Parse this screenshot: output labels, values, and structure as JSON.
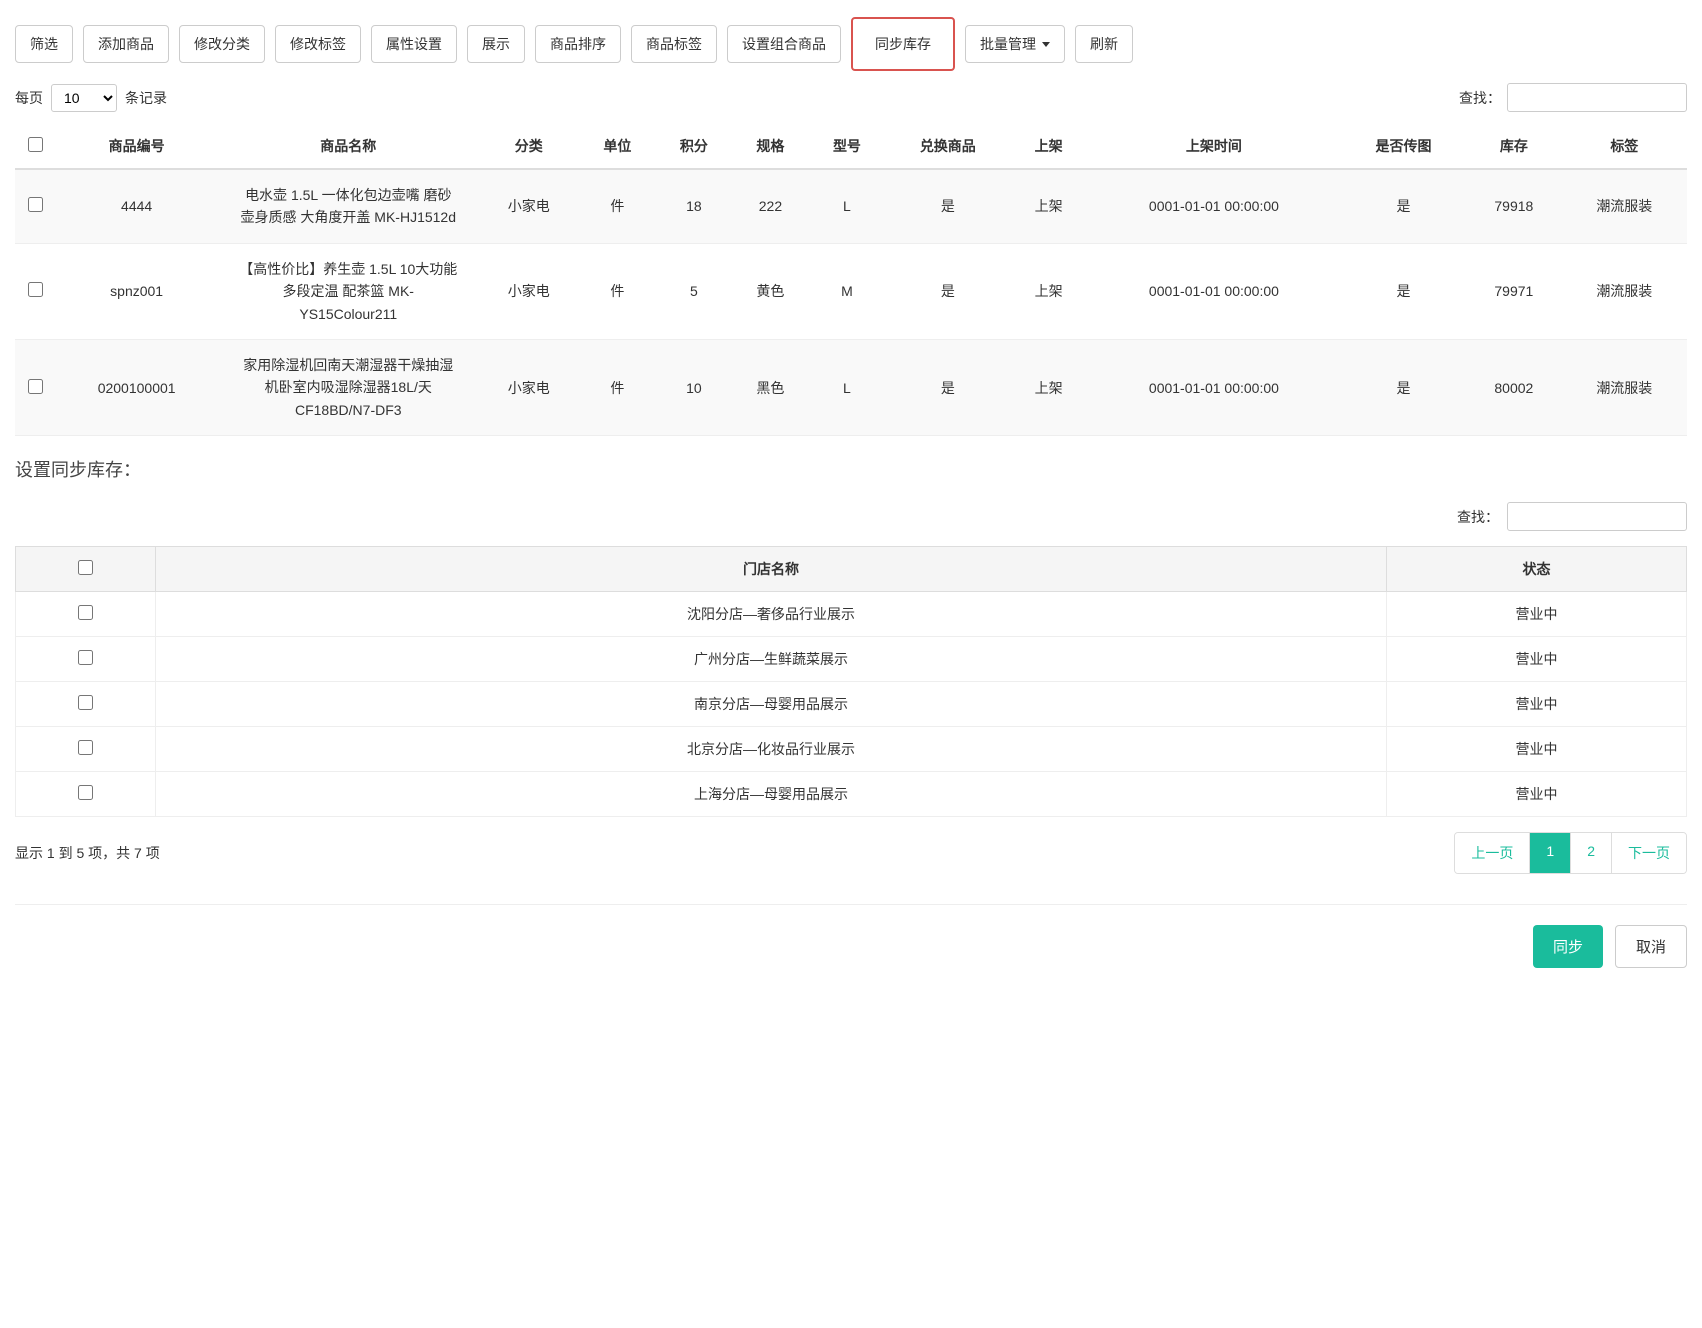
{
  "toolbar": {
    "filter": "筛选",
    "add_product": "添加商品",
    "edit_category": "修改分类",
    "edit_tags": "修改标签",
    "attr_settings": "属性设置",
    "display": "展示",
    "product_sort": "商品排序",
    "product_tags": "商品标签",
    "set_combo": "设置组合商品",
    "sync_stock": "同步库存",
    "batch_manage": "批量管理",
    "refresh": "刷新"
  },
  "page_size": {
    "prefix": "每页",
    "value": "10",
    "suffix": "条记录"
  },
  "search_label": "查找：",
  "product_table": {
    "headers": {
      "code": "商品编号",
      "name": "商品名称",
      "category": "分类",
      "unit": "单位",
      "points": "积分",
      "spec": "规格",
      "model": "型号",
      "exchange": "兑换商品",
      "on_shelf": "上架",
      "shelf_time": "上架时间",
      "has_image": "是否传图",
      "stock": "库存",
      "tags": "标签"
    },
    "rows": [
      {
        "code": "4444",
        "name": "电水壶 1.5L 一体化包边壶嘴 磨砂壶身质感 大角度开盖 MK-HJ1512d",
        "category": "小家电",
        "unit": "件",
        "points": "18",
        "spec": "222",
        "model": "L",
        "exchange": "是",
        "on_shelf": "上架",
        "shelf_time": "0001-01-01 00:00:00",
        "has_image": "是",
        "stock": "79918",
        "tags": "潮流服装"
      },
      {
        "code": "spnz001",
        "name": "【高性价比】养生壶 1.5L 10大功能 多段定温 配茶篮 MK-YS15Colour211",
        "category": "小家电",
        "unit": "件",
        "points": "5",
        "spec": "黄色",
        "model": "M",
        "exchange": "是",
        "on_shelf": "上架",
        "shelf_time": "0001-01-01 00:00:00",
        "has_image": "是",
        "stock": "79971",
        "tags": "潮流服装"
      },
      {
        "code": "0200100001",
        "name": "家用除湿机回南天潮湿器干燥抽湿机卧室内吸湿除湿器18L/天 CF18BD/N7-DF3",
        "category": "小家电",
        "unit": "件",
        "points": "10",
        "spec": "黑色",
        "model": "L",
        "exchange": "是",
        "on_shelf": "上架",
        "shelf_time": "0001-01-01 00:00:00",
        "has_image": "是",
        "stock": "80002",
        "tags": "潮流服装"
      }
    ]
  },
  "sync_section": {
    "title": "设置同步库存：",
    "search_label": "查找：",
    "headers": {
      "store_name": "门店名称",
      "status": "状态"
    },
    "rows": [
      {
        "name": "沈阳分店—奢侈品行业展示",
        "status": "营业中"
      },
      {
        "name": "广州分店—生鲜蔬菜展示",
        "status": "营业中"
      },
      {
        "name": "南京分店—母婴用品展示",
        "status": "营业中"
      },
      {
        "name": "北京分店—化妆品行业展示",
        "status": "营业中"
      },
      {
        "name": "上海分店—母婴用品展示",
        "status": "营业中"
      }
    ],
    "pagination_info": "显示 1 到 5 项，共 7 项",
    "prev": "上一页",
    "page1": "1",
    "page2": "2",
    "next": "下一页"
  },
  "footer": {
    "sync": "同步",
    "cancel": "取消"
  }
}
